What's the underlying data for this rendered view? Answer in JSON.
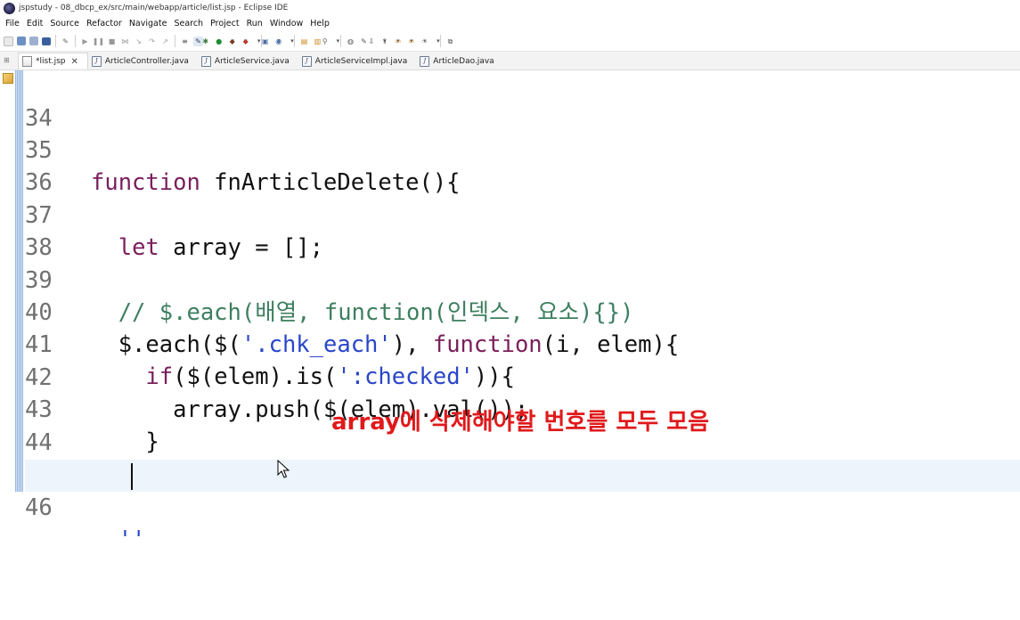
{
  "window": {
    "title": "jspstudy - 08_dbcp_ex/src/main/webapp/article/list.jsp - Eclipse IDE"
  },
  "menu": [
    "File",
    "Edit",
    "Source",
    "Refactor",
    "Navigate",
    "Search",
    "Project",
    "Run",
    "Window",
    "Help"
  ],
  "tabs": [
    {
      "label": "*list.jsp",
      "active": true,
      "closable": true
    },
    {
      "label": "ArticleController.java"
    },
    {
      "label": "ArticleService.java"
    },
    {
      "label": "ArticleServiceImpl.java"
    },
    {
      "label": "ArticleDao.java"
    }
  ],
  "editor": {
    "lines": [
      {
        "num": "34",
        "text": ""
      },
      {
        "num": "35",
        "text": "function fnArticleDelete(){"
      },
      {
        "num": "36",
        "text": ""
      },
      {
        "num": "37",
        "text": "  let array = [];"
      },
      {
        "num": "38",
        "text": ""
      },
      {
        "num": "39",
        "text": "  // $.each(배열, function(인덱스, 요소){})"
      },
      {
        "num": "40",
        "text": "  $.each($('.chk_each'), function(i, elem){"
      },
      {
        "num": "41",
        "text": "    if($(elem).is(':checked')){"
      },
      {
        "num": "42",
        "text": "      array.push($(elem).val());"
      },
      {
        "num": "43",
        "text": "    }"
      },
      {
        "num": "44",
        "text": "  })"
      },
      {
        "num": "45",
        "text": ""
      },
      {
        "num": "46",
        "text": "  ''"
      }
    ],
    "annotation": "array에 삭제해야할 번호를 모두 모음"
  }
}
